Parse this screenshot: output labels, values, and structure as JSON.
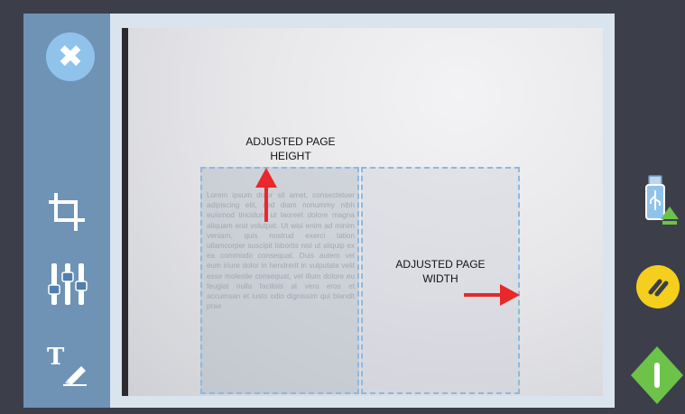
{
  "toolbar": {
    "close_icon": "close-icon",
    "crop_icon": "crop-icon",
    "levels_icon": "sliders-icon",
    "text_edit_icon": "text-edit-icon"
  },
  "preview": {
    "lorem_text": "Lorem ipsum dolor sit amet, consectetuer adipiscing elit, sed diam nonummy nibh euismod tincidunt ut laoreet dolore magna aliquam erat volutpat. Ut wisi enim ad minim veniam, quis nostrud exerci tation ullamcorper suscipit lobortis nisl ut aliquip ex ea commodo consequat. Duis autem vel eum iriure dolor in hendrerit in vulputate velit esse molestie consequat, vel illum dolore eu feugiat nulla facilisis at vero eros et accumsan et iusto odio dignissim qui blandit prae",
    "height_label_line1": "ADJUSTED PAGE",
    "height_label_line2": "HEIGHT",
    "width_label_line1": "ADJUSTED PAGE",
    "width_label_line2": "WIDTH"
  },
  "actions": {
    "usb_icon": "usb-save-icon",
    "pause_icon": "pause-icon",
    "start_icon": "start-icon"
  },
  "colors": {
    "sidebar": "#6f93b5",
    "frame": "#d9e4ef",
    "accent_blue": "#8fc3ec",
    "pause_yellow": "#f4cf1d",
    "go_green": "#6dc24a",
    "arrow_red": "#e8282b",
    "dash_blue": "#8db8e0"
  }
}
